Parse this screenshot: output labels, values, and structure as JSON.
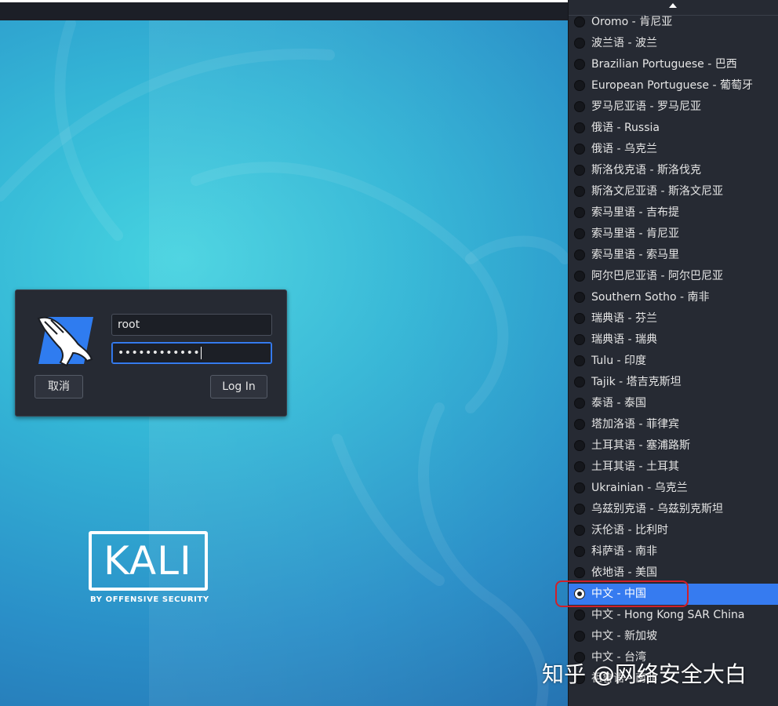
{
  "login": {
    "username": "root",
    "password_mask": "••••••••••••",
    "cancel_label": "取消",
    "login_label": "Log In"
  },
  "brand": {
    "word": "KALI",
    "tagline": "BY OFFENSIVE SECURITY"
  },
  "language_menu": {
    "selected_index": 27,
    "items": [
      "Oromo - 肯尼亚",
      "波兰语 - 波兰",
      "Brazilian Portuguese - 巴西",
      "European Portuguese - 葡萄牙",
      "罗马尼亚语 - 罗马尼亚",
      "俄语 - Russia",
      "俄语 - 乌克兰",
      "斯洛伐克语 - 斯洛伐克",
      "斯洛文尼亚语 - 斯洛文尼亚",
      "索马里语 - 吉布提",
      "索马里语 - 肯尼亚",
      "索马里语 - 索马里",
      "阿尔巴尼亚语 - 阿尔巴尼亚",
      "Southern Sotho - 南非",
      "瑞典语 - 芬兰",
      "瑞典语 - 瑞典",
      "Tulu - 印度",
      "Tajik - 塔吉克斯坦",
      "泰语 - 泰国",
      "塔加洛语 - 菲律宾",
      "土耳其语 - 塞浦路斯",
      "土耳其语 - 土耳其",
      "Ukrainian - 乌克兰",
      "乌兹别克语 - 乌兹别克斯坦",
      "沃伦语 - 比利时",
      "科萨语 - 南非",
      "依地语 - 美国",
      "中文 - 中国",
      "中文 - Hong Kong SAR China",
      "中文 - 新加坡",
      "中文 - 台湾",
      "祖鲁语 - 南非"
    ]
  },
  "watermark": "知乎 @网络安全大白",
  "colors": {
    "accent": "#367bf0",
    "annotation": "#d0202a"
  }
}
